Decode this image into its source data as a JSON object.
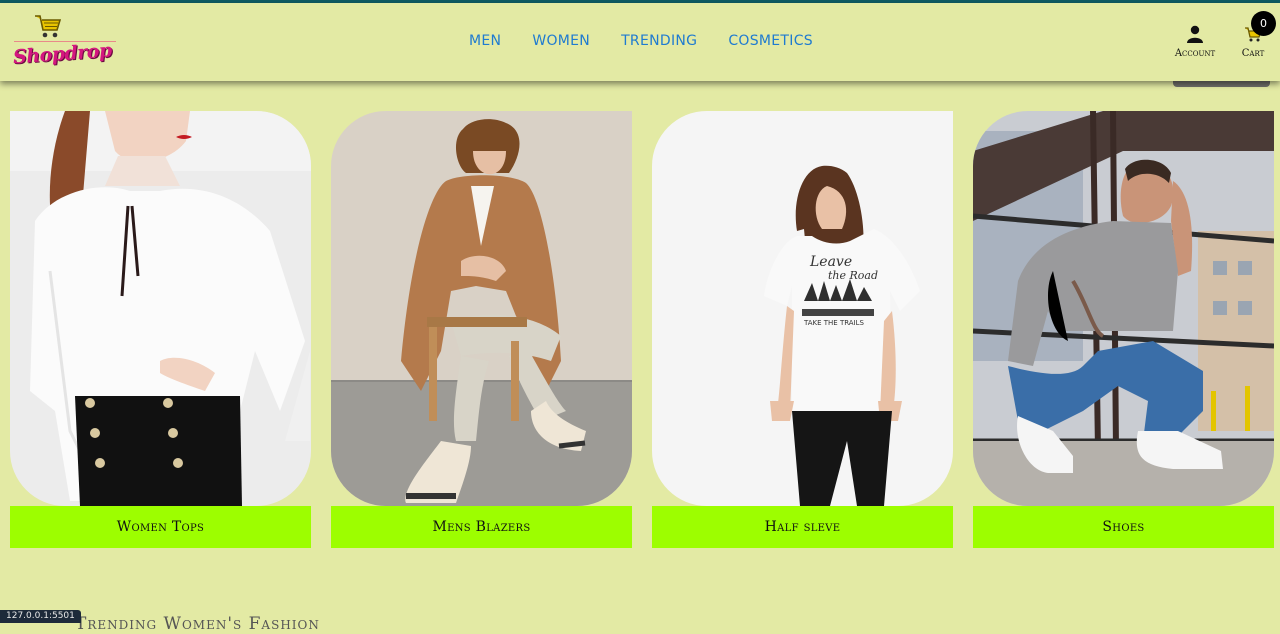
{
  "brand": {
    "logo_text": "Shopdrop"
  },
  "nav": {
    "items": [
      {
        "label": "MEN"
      },
      {
        "label": "WOMEN"
      },
      {
        "label": "TRENDING"
      },
      {
        "label": "COSMETICS"
      }
    ]
  },
  "header_actions": {
    "account_label": "Account",
    "cart_label": "Cart",
    "cart_count": "0"
  },
  "categories": [
    {
      "label": "Women Tops"
    },
    {
      "label": "Mens Blazers"
    },
    {
      "label": "Half sleve"
    },
    {
      "label": "Shoes"
    }
  ],
  "section_heading_partial": "Trending Women's Fashion",
  "status_url": "127.0.0.1:5501",
  "colors": {
    "page_bg": "#e3eaa4",
    "label_bg": "#9dfe00",
    "nav_link": "#1f7bd0",
    "logo_pink": "#d4177f"
  }
}
